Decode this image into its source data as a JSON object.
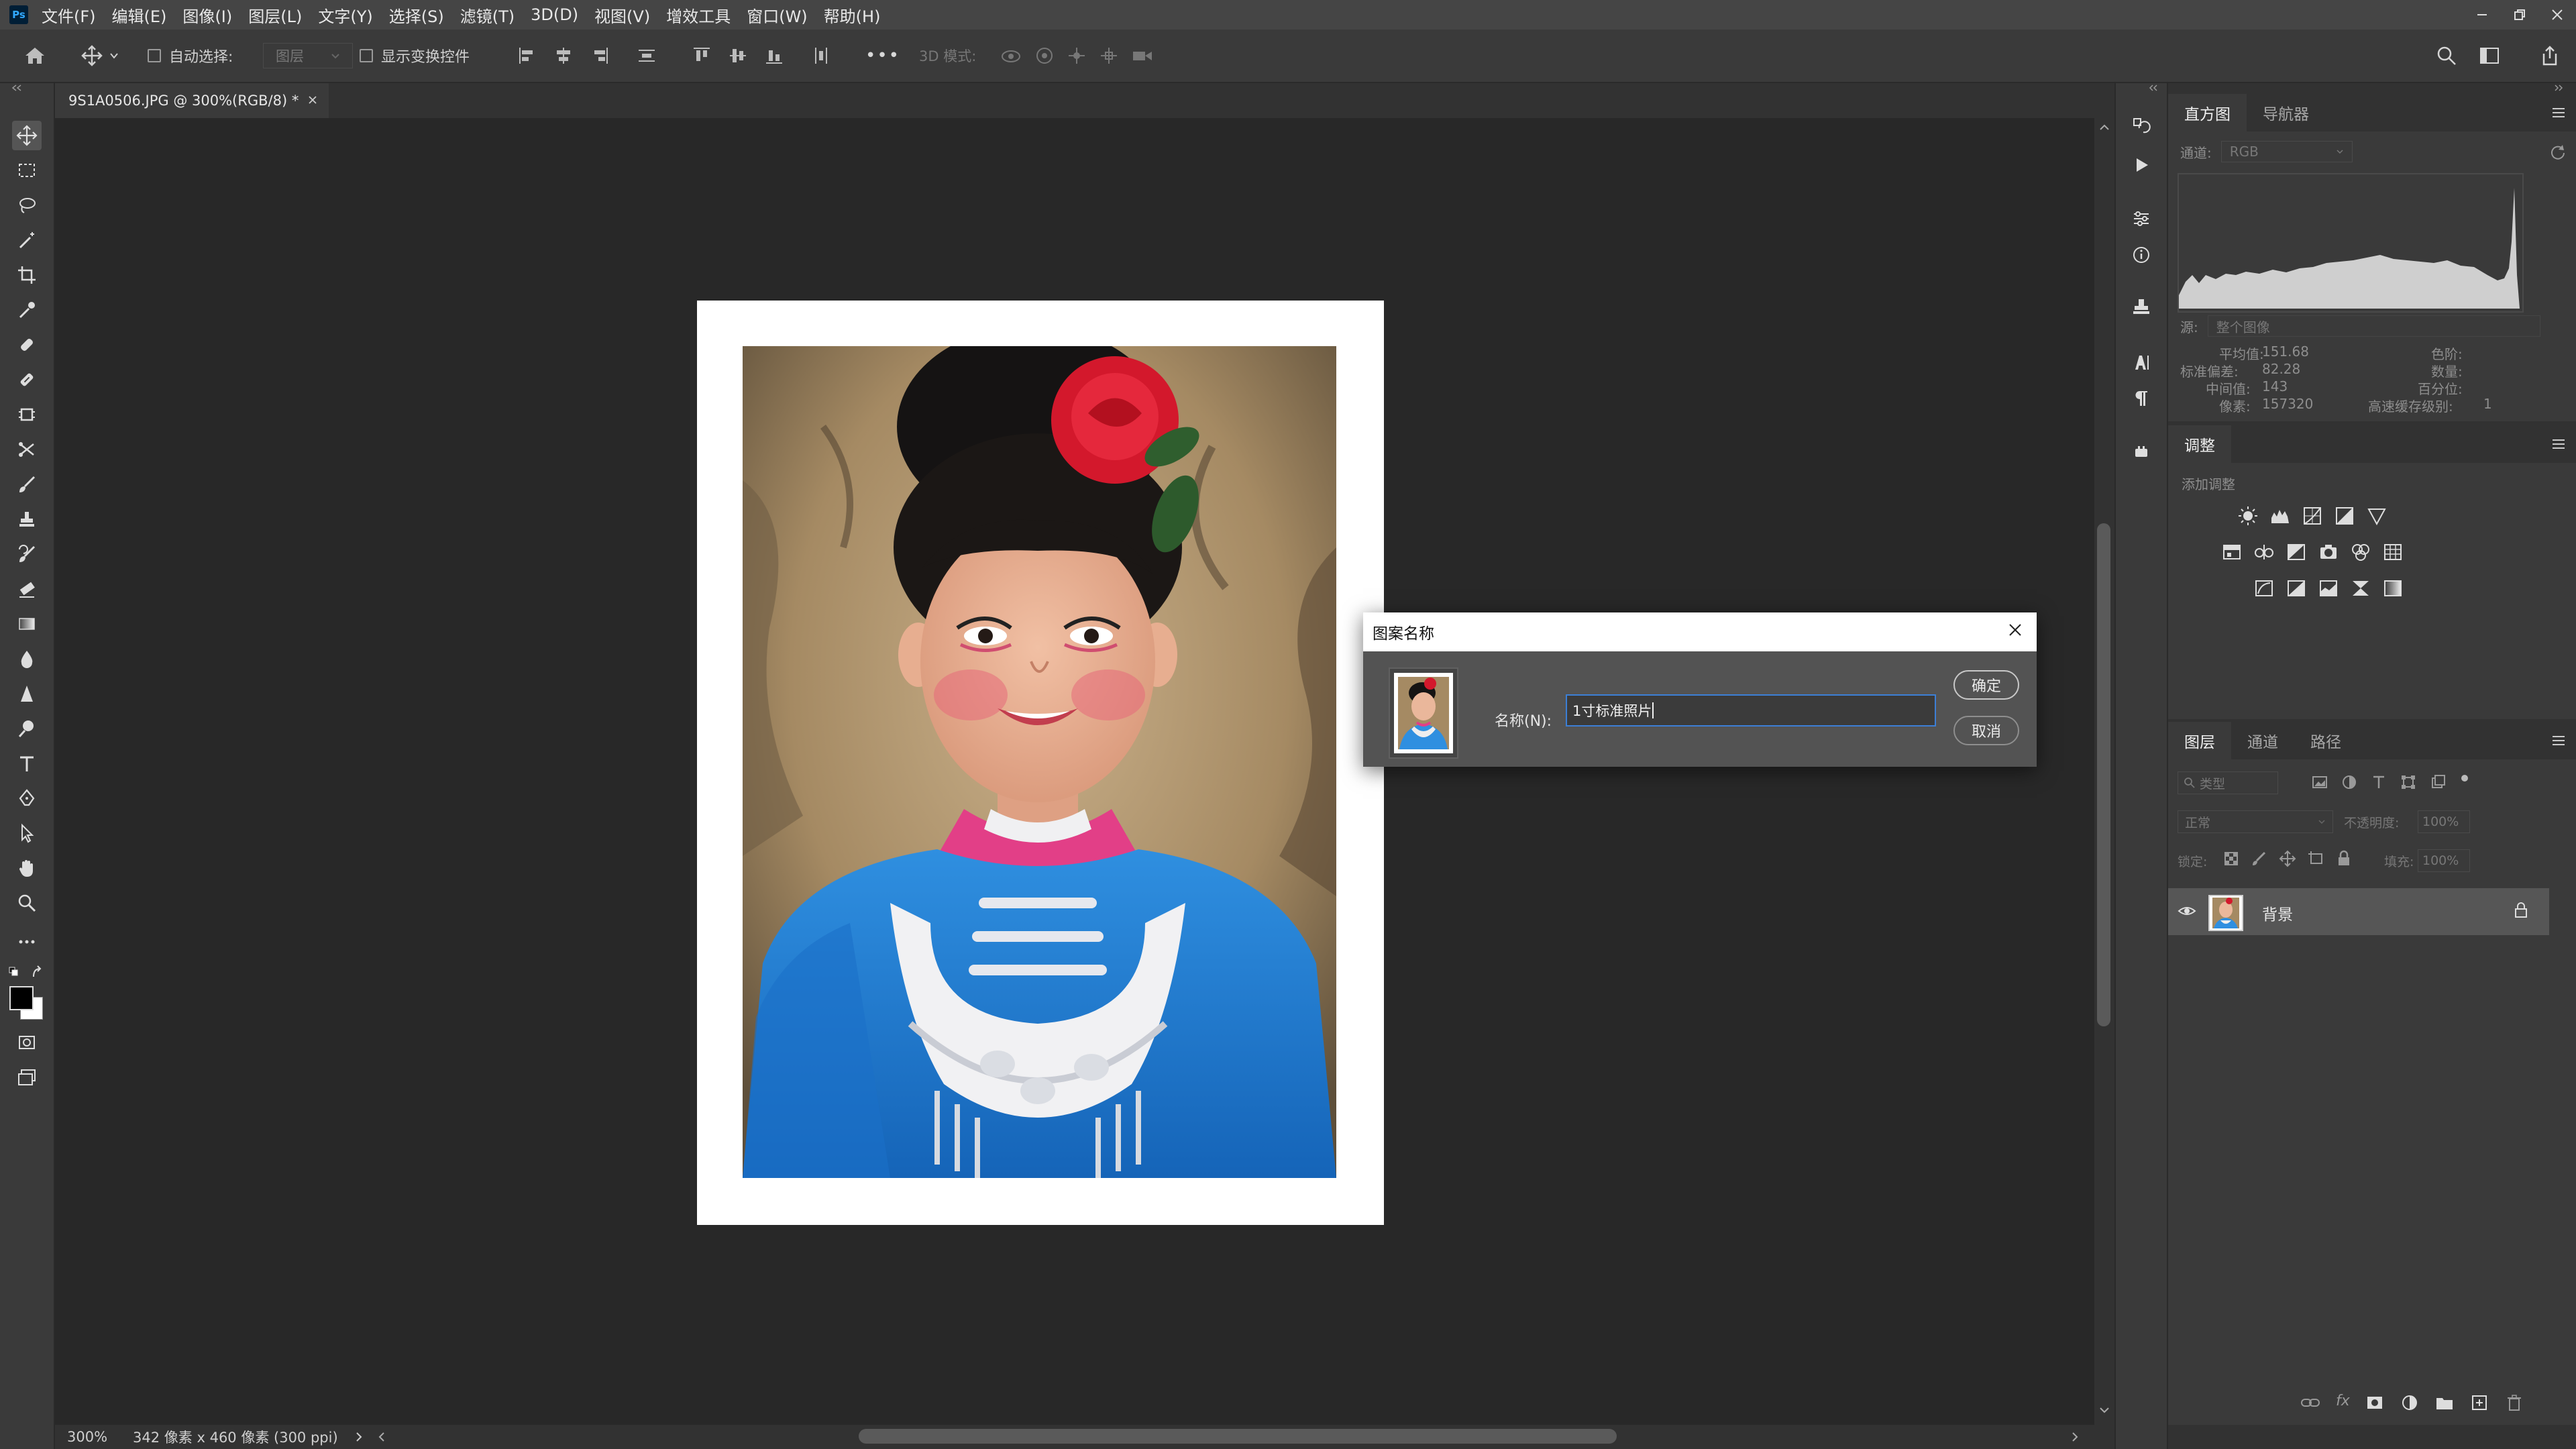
{
  "app": {
    "logo": "Ps",
    "menu": [
      "文件(F)",
      "编辑(E)",
      "图像(I)",
      "图层(L)",
      "文字(Y)",
      "选择(S)",
      "滤镜(T)",
      "3D(D)",
      "视图(V)",
      "增效工具",
      "窗口(W)",
      "帮助(H)"
    ],
    "window_controls": [
      "minimize-icon",
      "restore-icon",
      "close-icon"
    ]
  },
  "options_bar": {
    "auto_select_label": "自动选择:",
    "auto_select_target": "图层",
    "show_transform_label": "显示变换控件",
    "mode_3d_label": "3D 模式:",
    "more": "•••"
  },
  "document": {
    "tab_title": "9S1A0506.JPG @ 300%(RGB/8) *",
    "zoom": "300%",
    "info": "342 像素 x 460 像素 (300 ppi)"
  },
  "dialog": {
    "title": "图案名称",
    "name_label": "名称(N):",
    "name_value": "1寸标准照片",
    "ok_label": "确定",
    "cancel_label": "取消"
  },
  "histogram_panel": {
    "tabs": [
      "直方图",
      "导航器"
    ],
    "channel_label": "通道:",
    "channel_value": "RGB",
    "source_label": "源:",
    "source_value": "整个图像",
    "stats_left": [
      {
        "label": "平均值:",
        "value": "151.68"
      },
      {
        "label": "标准偏差:",
        "value": "82.28"
      },
      {
        "label": "中间值:",
        "value": "143"
      },
      {
        "label": "像素:",
        "value": "157320"
      }
    ],
    "stats_right": [
      {
        "label": "色阶:",
        "value": ""
      },
      {
        "label": "数量:",
        "value": ""
      },
      {
        "label": "百分位:",
        "value": ""
      },
      {
        "label": "高速缓存级别:",
        "value": "1"
      }
    ]
  },
  "adjustments_panel": {
    "title": "调整",
    "add_label": "添加调整"
  },
  "layers_panel": {
    "tabs": [
      "图层",
      "通道",
      "路径"
    ],
    "filter_placeholder": "类型",
    "blend_mode": "正常",
    "opacity_label": "不透明度:",
    "opacity_value": "100%",
    "lock_label": "锁定:",
    "fill_label": "填充:",
    "fill_value": "100%",
    "layers": [
      {
        "name": "背景",
        "visible": true,
        "locked": true
      }
    ]
  },
  "colors": {
    "accent": "#31a8ff",
    "input_border": "#3c7fd6",
    "workspace": "#282828",
    "panel": "#3a3a3a"
  }
}
